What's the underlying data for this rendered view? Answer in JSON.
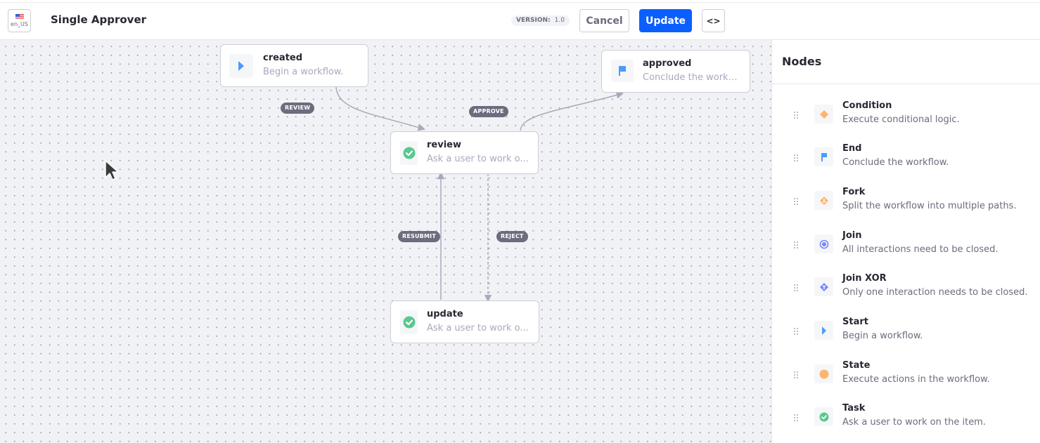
{
  "header": {
    "locale": "en_US",
    "title": "Single Approver",
    "version_label": "VERSION:",
    "version_value": "1.0",
    "cancel_label": "Cancel",
    "update_label": "Update",
    "code_label": "<>"
  },
  "canvas": {
    "nodes": [
      {
        "id": "created",
        "title": "created",
        "description": "Begin a workflow.",
        "icon": "start-icon"
      },
      {
        "id": "approved",
        "title": "approved",
        "description": "Conclude the workfl...",
        "icon": "end-flag-icon"
      },
      {
        "id": "review",
        "title": "review",
        "description": "Ask a user to work o...",
        "icon": "task-check-icon"
      },
      {
        "id": "update",
        "title": "update",
        "description": "Ask a user to work o...",
        "icon": "task-check-icon"
      }
    ],
    "edges": [
      {
        "label": "REVIEW",
        "from": "created",
        "to": "review"
      },
      {
        "label": "APPROVE",
        "from": "review",
        "to": "approved"
      },
      {
        "label": "RESUBMIT",
        "from": "update",
        "to": "review"
      },
      {
        "label": "REJECT",
        "from": "review",
        "to": "update"
      }
    ]
  },
  "panel": {
    "title": "Nodes",
    "items": [
      {
        "name": "Condition",
        "description": "Execute conditional logic.",
        "icon": "condition-icon"
      },
      {
        "name": "End",
        "description": "Conclude the workflow.",
        "icon": "end-flag-icon"
      },
      {
        "name": "Fork",
        "description": "Split the workflow into multiple paths.",
        "icon": "fork-icon"
      },
      {
        "name": "Join",
        "description": "All interactions need to be closed.",
        "icon": "join-icon"
      },
      {
        "name": "Join XOR",
        "description": "Only one interaction needs to be closed.",
        "icon": "join-xor-icon"
      },
      {
        "name": "Start",
        "description": "Begin a workflow.",
        "icon": "start-icon"
      },
      {
        "name": "State",
        "description": "Execute actions in the workflow.",
        "icon": "state-icon"
      },
      {
        "name": "Task",
        "description": "Ask a user to work on the item.",
        "icon": "task-check-icon"
      }
    ]
  },
  "colors": {
    "primary": "#0b5fff",
    "start": "#4b9bff",
    "task": "#5ac88f",
    "condition": "#ffb46e",
    "join": "#7785ff",
    "edge": "#a7a9bc",
    "edge_label_bg": "#6b6c7e"
  }
}
